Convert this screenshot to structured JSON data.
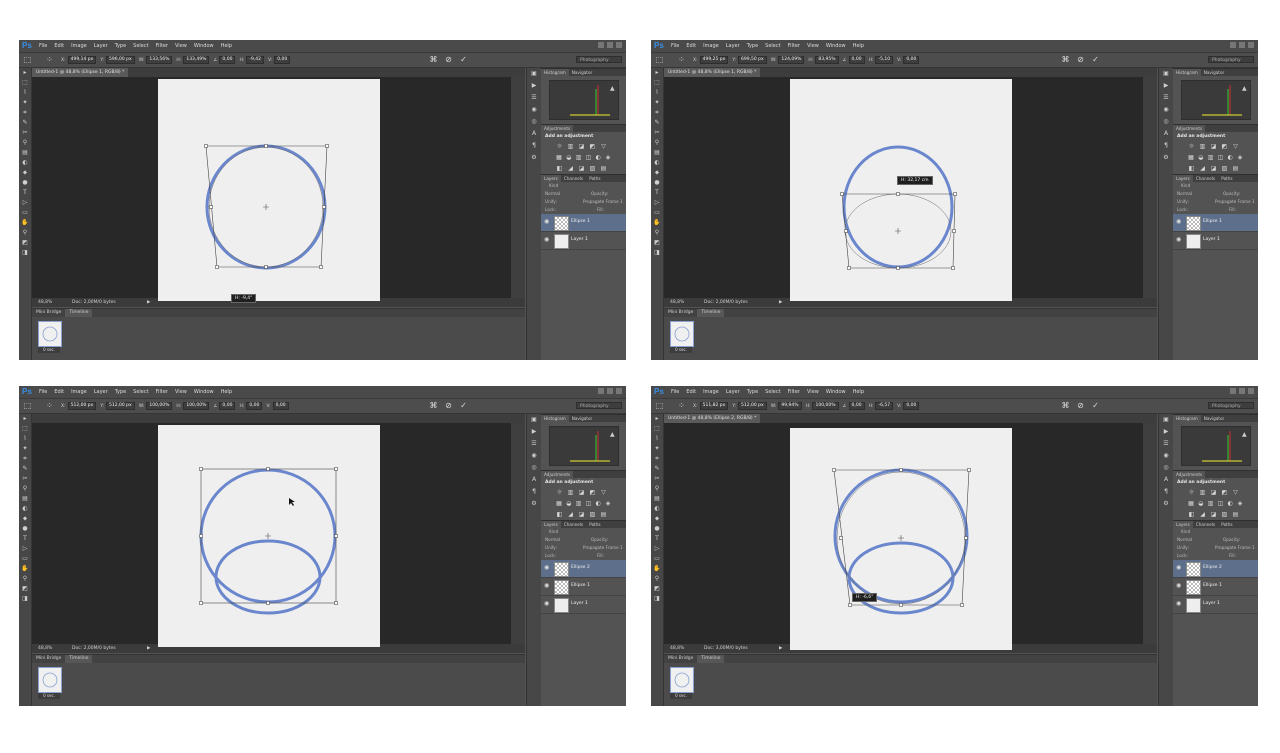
{
  "app": {
    "logo": "Ps",
    "menus": [
      "File",
      "Edit",
      "Image",
      "Layer",
      "Type",
      "Select",
      "Filter",
      "View",
      "Window",
      "Help"
    ],
    "workspace": "Photography"
  },
  "panels": {
    "histogram_tab": "Histogram",
    "navigator_tab": "Navigator",
    "adjustments_tab": "Adjustments",
    "add_adjustment": "Add an adjustment",
    "layers_tab": "Layers",
    "channels_tab": "Channels",
    "paths_tab": "Paths",
    "kind_label": "Kind",
    "blend_mode": "Normal",
    "opacity_label": "Opacity:",
    "unify_label": "Unify:",
    "propagate_label": "Propagate Frame 1",
    "lock_label": "Lock:",
    "fill_label": "Fill:",
    "mini_bridge_tab": "Mini Bridge",
    "timeline_tab": "Timeline"
  },
  "screens": [
    {
      "doc_tab": "Untitled-1 @ 48,8% (Ellipse 1, RGB/8) *",
      "options": {
        "x": "499,14 px",
        "y": "596,00 px",
        "w": "133,56%",
        "h": "133,49%",
        "angle": "0,00",
        "hskew": "-9,42",
        "vskew": "0,00"
      },
      "zoom": "48,8%",
      "doc_info": "Doc: 2,00M/0 bytes",
      "tooltip": "H: -9,4°",
      "thumb_time": "0 sec.",
      "layers": [
        "Ellipse 1",
        "Layer 1"
      ],
      "selected_layer": 0
    },
    {
      "doc_tab": "Untitled-1 @ 48,8% (Ellipse 1, RGB/8) *",
      "options": {
        "x": "499,25 px",
        "y": "699,50 px",
        "w": "124,09%",
        "h": "83,95%",
        "angle": "0,00",
        "hskew": "-5,10",
        "vskew": "0,00"
      },
      "zoom": "48,8%",
      "doc_info": "Doc: 2,00M/0 bytes",
      "tooltip": "H: 32,17 cm",
      "thumb_time": "0 sec.",
      "layers": [
        "Ellipse 1",
        "Layer 1"
      ],
      "selected_layer": 0
    },
    {
      "doc_tab": "",
      "options": {
        "x": "512,00 px",
        "y": "512,00 px",
        "w": "100,00%",
        "h": "100,00%",
        "angle": "0,00",
        "hskew": "0,00",
        "vskew": "0,00"
      },
      "zoom": "48,8%",
      "doc_info": "Doc: 2,00M/0 bytes",
      "tooltip": "",
      "thumb_time": "0 sec.",
      "layers": [
        "Ellipse 2",
        "Ellipse 1",
        "Layer 1"
      ],
      "selected_layer": 0
    },
    {
      "doc_tab": "Untitled-1 @ 48,8% (Ellipse 2, RGB/8) *",
      "options": {
        "x": "511,82 px",
        "y": "512,00 px",
        "w": "99,94%",
        "h": "100,00%",
        "angle": "0,00",
        "hskew": "-6,57",
        "vskew": "0,00"
      },
      "zoom": "48,8%",
      "doc_info": "Doc: 3,00M/0 bytes",
      "tooltip": "H: -6,6°",
      "thumb_time": "0 sec.",
      "layers": [
        "Ellipse 2",
        "Ellipse 1",
        "Layer 1"
      ],
      "selected_layer": 0
    }
  ]
}
